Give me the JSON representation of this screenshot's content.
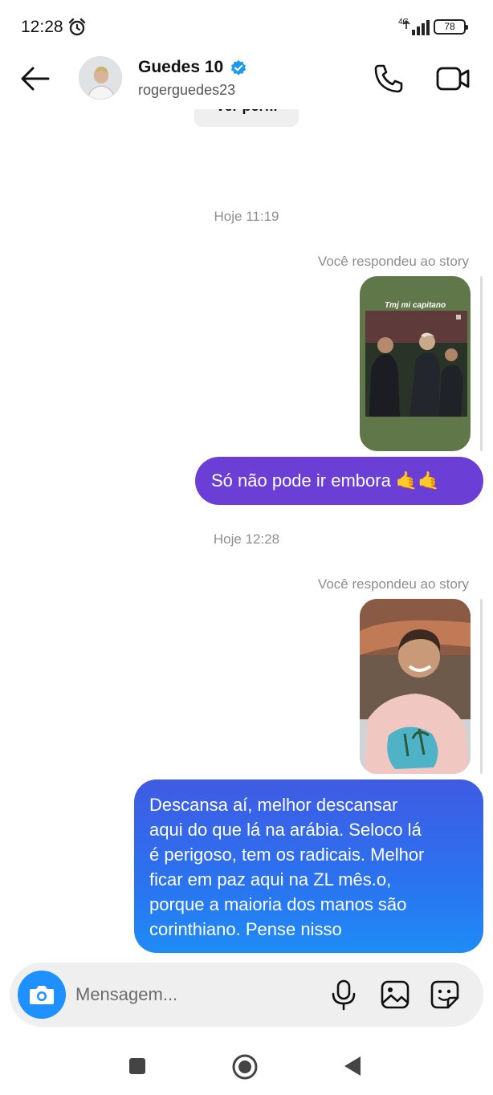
{
  "status_bar": {
    "time": "12:28",
    "network_type": "4G",
    "battery_level": "78",
    "icons": [
      "alarm-icon",
      "signal-icon",
      "battery-icon"
    ]
  },
  "header": {
    "contact_name": "Guedes 10",
    "contact_handle": "rogerguedes23",
    "verified": true,
    "icons": [
      "back-arrow-icon",
      "verified-badge-icon",
      "phone-icon",
      "video-call-icon"
    ]
  },
  "view_profile_label": "Ver perfil",
  "messages": [
    {
      "timestamp": "Hoje 11:19",
      "reply_label": "Você respondeu ao story",
      "story_caption": "Tmj mi capitano",
      "text": "Só não pode ir embora 🤙🤙"
    },
    {
      "timestamp": "Hoje 12:28",
      "reply_label": "Você respondeu ao story",
      "text": "Descansa aí, melhor descansar\naqui do que lá na arábia. Seloco lá\né perigoso, tem os radicais. Melhor\nficar em paz aqui na ZL mês.o,\nporque a maioria dos manos são\ncorinthiano. Pense nisso"
    }
  ],
  "composer": {
    "placeholder": "Mensagem...",
    "icons": [
      "camera-icon",
      "microphone-icon",
      "gallery-icon",
      "sticker-icon"
    ]
  },
  "nav_bar": {
    "icons": [
      "recents-square-icon",
      "home-circle-icon",
      "back-triangle-icon"
    ]
  },
  "colors": {
    "sent_bubble_purple": "#6b3fd6",
    "sent_bubble_blue": "#2a73f0",
    "verified_badge": "#1d9bf0",
    "camera_button": "#1e90ff",
    "muted_text": "#8e8e8e"
  }
}
